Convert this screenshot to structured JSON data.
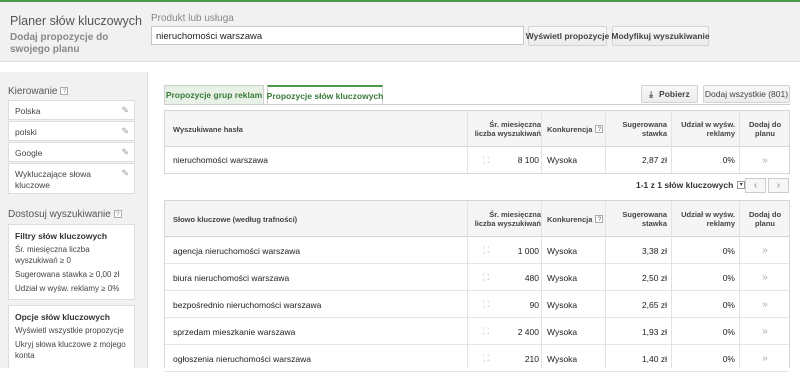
{
  "header": {
    "title": "Planer słów kluczowych",
    "subtitle": "Dodaj propozycje do swojego planu",
    "product_label": "Produkt lub usługa",
    "search_value": "nieruchomości warszawa",
    "show_btn": "Wyświetl propozycje",
    "modify_btn": "Modyfikuj wyszukiwanie"
  },
  "sidebar": {
    "targeting_title": "Kierowanie",
    "targeting_items": [
      "Polska",
      "polski",
      "Google",
      "Wykluczające słowa kluczowe"
    ],
    "customize_title": "Dostosuj wyszukiwanie",
    "filters": {
      "title": "Filtry słów kluczowych",
      "lines": [
        "Śr. miesięczna liczba wyszukiwań ≥ 0",
        "Sugerowana stawka ≥ 0,00 zł",
        "Udział w wyśw. reklamy ≥ 0%"
      ]
    },
    "options": {
      "title": "Opcje słów kluczowych",
      "lines": [
        "Wyświetl wszystkie propozycje",
        "Ukryj słowa kluczowe z mojego konta"
      ]
    }
  },
  "tabs": [
    "Propozycje grup reklam",
    "Propozycje słów kluczowych"
  ],
  "toolbar": {
    "download": "Pobierz",
    "add_all": "Dodaj wszystkie (801)"
  },
  "search_terms_table": {
    "headers": [
      "Wyszukiwane hasła",
      "Śr. miesięczna liczba wyszukiwań",
      "Konkurencja",
      "Sugerowana stawka",
      "Udział w wyśw. reklamy",
      "Dodaj do planu"
    ],
    "rows": [
      {
        "keyword": "nieruchomości warszawa",
        "searches": "8 100",
        "competition": "Wysoka",
        "bid": "2,87 zł",
        "share": "0%"
      }
    ]
  },
  "pager": {
    "text": "1-1 z 1 słów kluczowych"
  },
  "keywords_table": {
    "headers": [
      "Słowo kluczowe (według trafności)",
      "Śr. miesięczna liczba wyszukiwań",
      "Konkurencja",
      "Sugerowana stawka",
      "Udział w wyśw. reklamy",
      "Dodaj do planu"
    ],
    "rows": [
      {
        "keyword": "agencja nieruchomości warszawa",
        "searches": "1 000",
        "competition": "Wysoka",
        "bid": "3,38 zł",
        "share": "0%"
      },
      {
        "keyword": "biura nieruchomości warszawa",
        "searches": "480",
        "competition": "Wysoka",
        "bid": "2,50 zł",
        "share": "0%"
      },
      {
        "keyword": "bezpośrednio nieruchomości warszawa",
        "searches": "90",
        "competition": "Wysoka",
        "bid": "2,65 zł",
        "share": "0%"
      },
      {
        "keyword": "sprzedam mieszkanie warszawa",
        "searches": "2 400",
        "competition": "Wysoka",
        "bid": "1,93 zł",
        "share": "0%"
      },
      {
        "keyword": "ogłoszenia nieruchomości warszawa",
        "searches": "210",
        "competition": "Wysoka",
        "bid": "1,40 zł",
        "share": "0%"
      }
    ]
  },
  "icons": {
    "help": "help-icon",
    "edit": "pencil-icon",
    "trend": "trend-chart-icon",
    "add": "add-chevrons-icon",
    "download": "download-icon"
  },
  "colors": {
    "accent_green": "#4a9a4a",
    "sidebar_bg": "#f1f1f1"
  }
}
